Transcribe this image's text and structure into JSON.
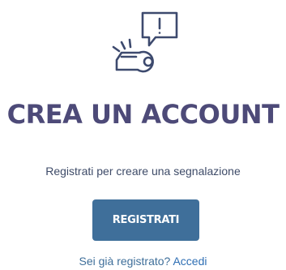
{
  "logo": {
    "icon": "whistle-alert-icon",
    "color": "#3d4a6e"
  },
  "heading": {
    "title": "CREA UN ACCOUNT"
  },
  "intro": {
    "text": "Registrati per creare una segnalazione"
  },
  "register_button": {
    "label": "REGISTRATI",
    "color": "#3f6f9a"
  },
  "login_prompt": {
    "text": "Sei già registrato?",
    "link_label": "Accedi"
  }
}
